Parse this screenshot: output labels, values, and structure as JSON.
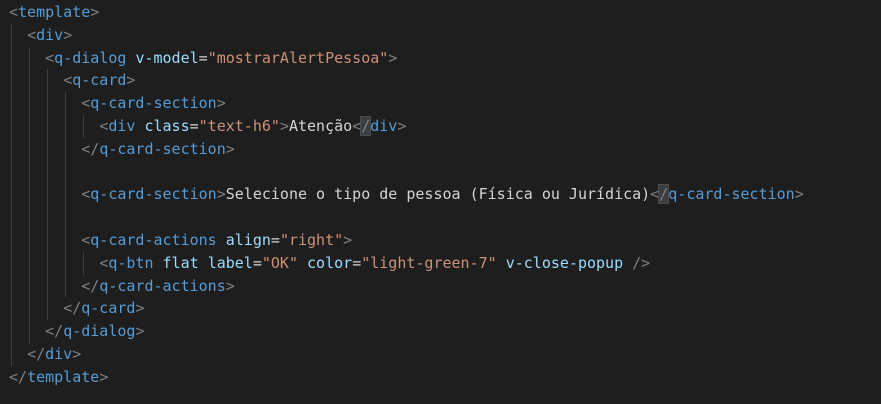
{
  "editor": {
    "background": "#1e1e1e",
    "colors": {
      "punct": "#808080",
      "tag": "#569cd6",
      "attr": "#9cdcfe",
      "string": "#ce9178",
      "text": "#d4d4d4"
    },
    "lines": [
      {
        "indent": 0,
        "tokens": [
          [
            "punct",
            "<"
          ],
          [
            "tag",
            "template"
          ],
          [
            "punct",
            ">"
          ]
        ]
      },
      {
        "indent": 1,
        "tokens": [
          [
            "punct",
            "<"
          ],
          [
            "tag",
            "div"
          ],
          [
            "punct",
            ">"
          ]
        ]
      },
      {
        "indent": 2,
        "tokens": [
          [
            "punct",
            "<"
          ],
          [
            "tag",
            "q-dialog"
          ],
          [
            "text",
            " "
          ],
          [
            "attr",
            "v-model"
          ],
          [
            "eq",
            "="
          ],
          [
            "str",
            "\"mostrarAlertPessoa\""
          ],
          [
            "punct",
            ">"
          ]
        ]
      },
      {
        "indent": 3,
        "tokens": [
          [
            "punct",
            "<"
          ],
          [
            "tag",
            "q-card"
          ],
          [
            "punct",
            ">"
          ]
        ]
      },
      {
        "indent": 4,
        "tokens": [
          [
            "punct",
            "<"
          ],
          [
            "tag",
            "q-card-section"
          ],
          [
            "punct",
            ">"
          ]
        ]
      },
      {
        "indent": 5,
        "tokens": [
          [
            "punct",
            "<"
          ],
          [
            "tag",
            "div"
          ],
          [
            "text",
            " "
          ],
          [
            "attr",
            "class"
          ],
          [
            "eq",
            "="
          ],
          [
            "str",
            "\"text-h6\""
          ],
          [
            "punct",
            ">"
          ],
          [
            "text",
            "Atenção"
          ],
          [
            "punct",
            "<"
          ],
          [
            "punctm",
            "/"
          ],
          [
            "tag",
            "div"
          ],
          [
            "punct",
            ">"
          ]
        ]
      },
      {
        "indent": 4,
        "tokens": [
          [
            "punct",
            "</"
          ],
          [
            "tag",
            "q-card-section"
          ],
          [
            "punct",
            ">"
          ]
        ]
      },
      {
        "indent": 0,
        "tokens": []
      },
      {
        "indent": 4,
        "tokens": [
          [
            "punct",
            "<"
          ],
          [
            "tag",
            "q-card-section"
          ],
          [
            "punct",
            ">"
          ],
          [
            "text",
            "Selecione o tipo de pessoa (Física ou Jurídica)"
          ],
          [
            "punct",
            "<"
          ],
          [
            "punctm",
            "/"
          ],
          [
            "tag",
            "q-card-section"
          ],
          [
            "punct",
            ">"
          ]
        ]
      },
      {
        "indent": 0,
        "tokens": []
      },
      {
        "indent": 4,
        "tokens": [
          [
            "punct",
            "<"
          ],
          [
            "tag",
            "q-card-actions"
          ],
          [
            "text",
            " "
          ],
          [
            "attr",
            "align"
          ],
          [
            "eq",
            "="
          ],
          [
            "str",
            "\"right\""
          ],
          [
            "punct",
            ">"
          ]
        ]
      },
      {
        "indent": 5,
        "tokens": [
          [
            "punct",
            "<"
          ],
          [
            "tag",
            "q-btn"
          ],
          [
            "text",
            " "
          ],
          [
            "attr",
            "flat"
          ],
          [
            "text",
            " "
          ],
          [
            "attr",
            "label"
          ],
          [
            "eq",
            "="
          ],
          [
            "str",
            "\"OK\""
          ],
          [
            "text",
            " "
          ],
          [
            "attr",
            "color"
          ],
          [
            "eq",
            "="
          ],
          [
            "str",
            "\"light-green-7\""
          ],
          [
            "text",
            " "
          ],
          [
            "attr",
            "v-close-popup"
          ],
          [
            "text",
            " "
          ],
          [
            "punct",
            "/>"
          ]
        ]
      },
      {
        "indent": 4,
        "tokens": [
          [
            "punct",
            "</"
          ],
          [
            "tag",
            "q-card-actions"
          ],
          [
            "punct",
            ">"
          ]
        ]
      },
      {
        "indent": 3,
        "tokens": [
          [
            "punct",
            "</"
          ],
          [
            "tag",
            "q-card"
          ],
          [
            "punct",
            ">"
          ]
        ]
      },
      {
        "indent": 2,
        "tokens": [
          [
            "punct",
            "</"
          ],
          [
            "tag",
            "q-dialog"
          ],
          [
            "punct",
            ">"
          ]
        ]
      },
      {
        "indent": 1,
        "tokens": [
          [
            "punct",
            "</"
          ],
          [
            "tag",
            "div"
          ],
          [
            "punct",
            ">"
          ]
        ]
      },
      {
        "indent": 0,
        "tokens": [
          [
            "punct",
            "</"
          ],
          [
            "tag",
            "template"
          ],
          [
            "punct",
            ">"
          ]
        ]
      }
    ]
  }
}
